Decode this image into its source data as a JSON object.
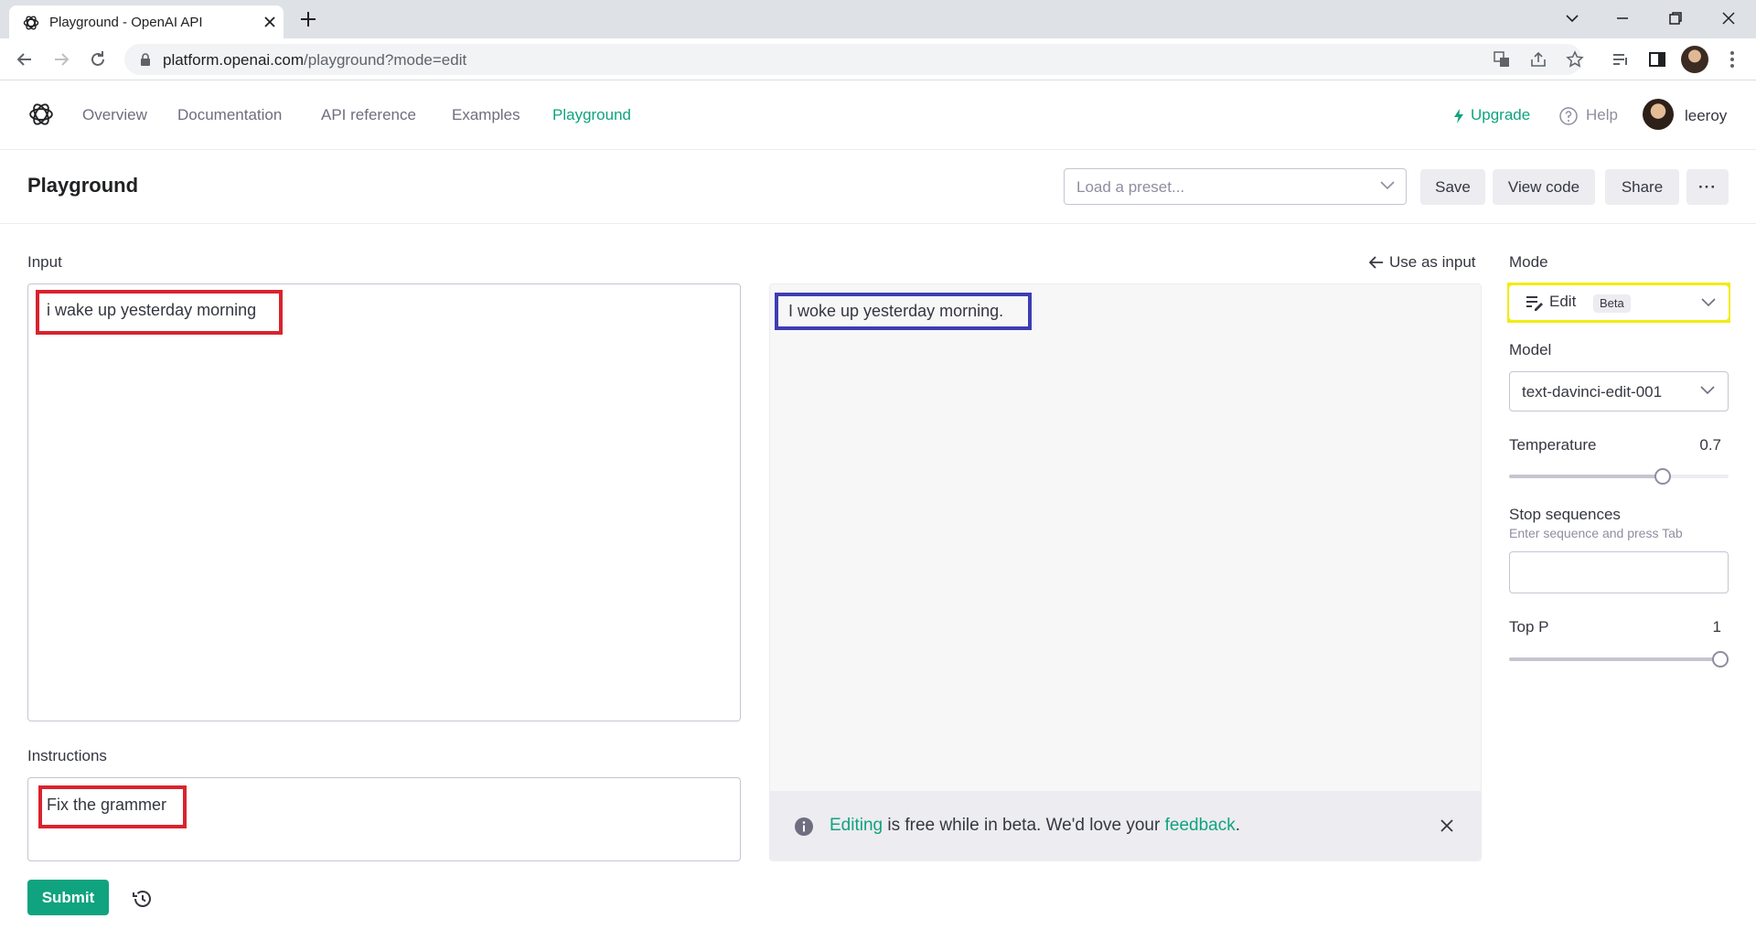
{
  "browser": {
    "tab_title": "Playground - OpenAI API",
    "url_host": "platform.openai.com",
    "url_path": "/playground?mode=edit"
  },
  "nav": {
    "links": [
      "Overview",
      "Documentation",
      "API reference",
      "Examples",
      "Playground"
    ],
    "active": "Playground",
    "upgrade": "Upgrade",
    "help": "Help",
    "username": "leeroy"
  },
  "header": {
    "title": "Playground",
    "preset_placeholder": "Load a preset...",
    "save": "Save",
    "view_code": "View code",
    "share": "Share",
    "more": "···"
  },
  "input": {
    "label": "Input",
    "value": "i wake up yesterday morning"
  },
  "instructions": {
    "label": "Instructions",
    "value": "Fix the grammer"
  },
  "submit": "Submit",
  "output": {
    "use_as_input": "Use as input",
    "value": "I woke up yesterday morning.",
    "beta_link1": "Editing",
    "beta_text": " is free while in beta. We'd love your ",
    "beta_link2": "feedback",
    "beta_end": "."
  },
  "settings": {
    "mode_label": "Mode",
    "mode_value": "Edit",
    "mode_badge": "Beta",
    "model_label": "Model",
    "model_value": "text-davinci-edit-001",
    "temperature_label": "Temperature",
    "temperature_value": "0.7",
    "temperature_fraction": 0.7,
    "stop_label": "Stop sequences",
    "stop_hint": "Enter sequence and press Tab",
    "topp_label": "Top P",
    "topp_value": "1",
    "topp_fraction": 1.0
  },
  "colors": {
    "accent": "#10a37f",
    "highlight_red": "#d9232e",
    "highlight_blue": "#3d3db2",
    "highlight_yellow": "#f2ec12"
  }
}
